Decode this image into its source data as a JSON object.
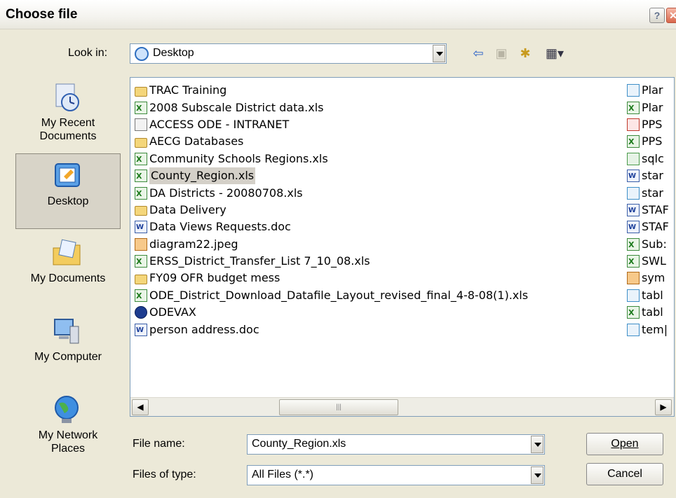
{
  "window": {
    "title": "Choose file",
    "help_glyph": "?",
    "close_glyph": "✕"
  },
  "lookin": {
    "label": "Look in:",
    "value": "Desktop"
  },
  "toolbar": {
    "back_glyph": "⇦",
    "up_glyph": "▣",
    "newfolder_glyph": "✱",
    "views_glyph": "▦▾"
  },
  "places": [
    {
      "label_line1": "My Recent",
      "label_line2": "Documents",
      "icon": "recent-documents-icon"
    },
    {
      "label_line1": "Desktop",
      "label_line2": "",
      "icon": "desktop-icon"
    },
    {
      "label_line1": "My Documents",
      "label_line2": "",
      "icon": "my-documents-icon"
    },
    {
      "label_line1": "My Computer",
      "label_line2": "",
      "icon": "my-computer-icon"
    },
    {
      "label_line1": "My Network",
      "label_line2": "Places",
      "icon": "network-places-icon"
    }
  ],
  "files_col1": [
    {
      "name": "TRAC Training",
      "type": "folder"
    },
    {
      "name": "2008 Subscale District data.xls",
      "type": "xls"
    },
    {
      "name": "ACCESS ODE - INTRANET",
      "type": "link"
    },
    {
      "name": "AECG Databases",
      "type": "folder"
    },
    {
      "name": "Community Schools Regions.xls",
      "type": "xls"
    },
    {
      "name": "County_Region.xls",
      "type": "xls",
      "selected": true
    },
    {
      "name": "DA Districts - 20080708.xls",
      "type": "xls"
    },
    {
      "name": "Data Delivery",
      "type": "folder"
    },
    {
      "name": "Data Views Requests.doc",
      "type": "doc"
    },
    {
      "name": "diagram22.jpeg",
      "type": "img"
    },
    {
      "name": "ERSS_District_Transfer_List 7_10_08.xls",
      "type": "xls"
    },
    {
      "name": "FY09 OFR budget mess",
      "type": "folder"
    },
    {
      "name": "ODE_District_Download_Datafile_Layout_revised_final_4-8-08(1).xls",
      "type": "xls"
    },
    {
      "name": "ODEVAX",
      "type": "odevax"
    },
    {
      "name": "person address.doc",
      "type": "doc"
    }
  ],
  "files_col2": [
    {
      "name": "Plar",
      "type": "file"
    },
    {
      "name": "Plar",
      "type": "xls"
    },
    {
      "name": "PPS",
      "type": "pdf"
    },
    {
      "name": "PPS",
      "type": "xls"
    },
    {
      "name": "sqlc",
      "type": "sql"
    },
    {
      "name": "star",
      "type": "doc"
    },
    {
      "name": "star",
      "type": "file"
    },
    {
      "name": "STAF",
      "type": "doc"
    },
    {
      "name": "STAF",
      "type": "doc"
    },
    {
      "name": "Sub:",
      "type": "xls"
    },
    {
      "name": "SWL",
      "type": "xls"
    },
    {
      "name": "sym",
      "type": "img"
    },
    {
      "name": "tabl",
      "type": "file"
    },
    {
      "name": "tabl",
      "type": "xls"
    },
    {
      "name": "tem|",
      "type": "file"
    }
  ],
  "scroll": {
    "left_glyph": "◀",
    "right_glyph": "▶",
    "thumb_glyph": "|||"
  },
  "filename": {
    "label": "File name:",
    "value": "County_Region.xls"
  },
  "filetype": {
    "label": "Files of type:",
    "value": "All Files (*.*)"
  },
  "buttons": {
    "open": "Open",
    "cancel": "Cancel"
  }
}
